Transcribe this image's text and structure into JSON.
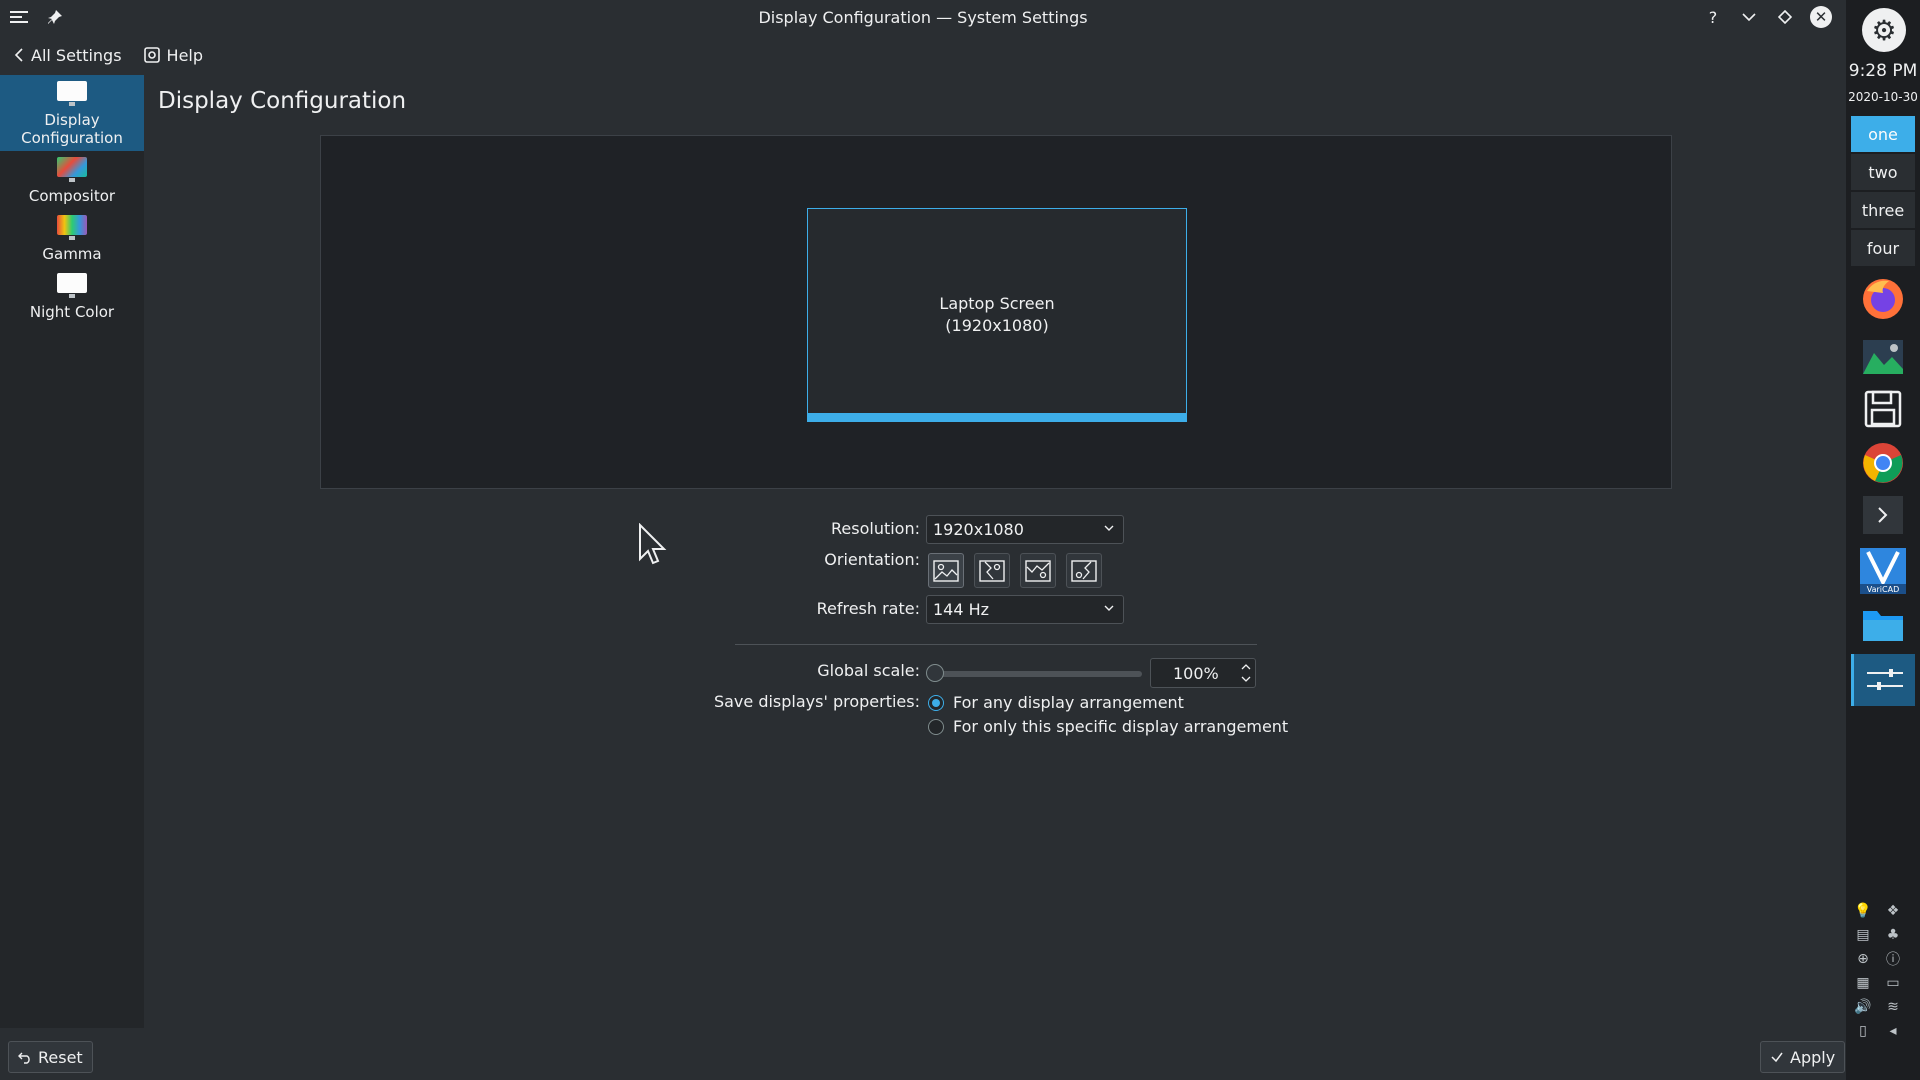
{
  "window": {
    "title": "Display Configuration — System Settings"
  },
  "toolbar": {
    "back_label": "All Settings",
    "help_label": "Help"
  },
  "sidebar": {
    "items": [
      {
        "label": "Display Configuration",
        "icon": "monitor-icon",
        "active": true
      },
      {
        "label": "Compositor",
        "icon": "compositor-icon"
      },
      {
        "label": "Gamma",
        "icon": "gamma-icon"
      },
      {
        "label": "Night Color",
        "icon": "night-color-icon"
      }
    ]
  },
  "main": {
    "title": "Display Configuration",
    "screen": {
      "name": "Laptop Screen",
      "resolution_label": "(1920x1080)"
    },
    "form": {
      "resolution_label": "Resolution:",
      "resolution_value": "1920x1080",
      "orientation_label": "Orientation:",
      "refresh_label": "Refresh rate:",
      "refresh_value": "144 Hz",
      "scale_label": "Global scale:",
      "scale_value": "100%",
      "save_label": "Save displays' properties:",
      "save_options": [
        {
          "label": "For any display arrangement",
          "checked": true
        },
        {
          "label": "For only this specific display arrangement",
          "checked": false
        }
      ]
    }
  },
  "bottom": {
    "reset_label": "Reset",
    "apply_label": "Apply"
  },
  "panel": {
    "time": "9:28 PM",
    "date": "2020-10-30",
    "desktops": [
      "one",
      "two",
      "three",
      "four"
    ],
    "active_desktop": "one"
  },
  "colors": {
    "accent": "#3daee9",
    "background": "#2a2e32",
    "sidebar": "#232629"
  }
}
